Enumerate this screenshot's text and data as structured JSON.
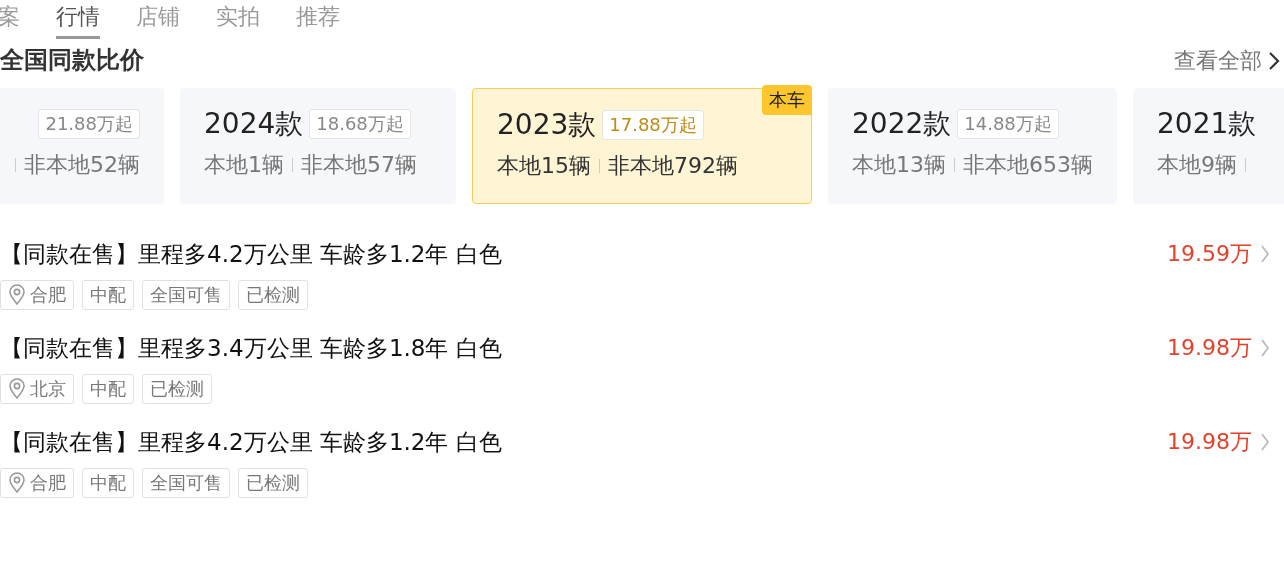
{
  "tabs": [
    {
      "label": "案",
      "selected": false
    },
    {
      "label": "行情",
      "selected": true
    },
    {
      "label": "店铺",
      "selected": false
    },
    {
      "label": "实拍",
      "selected": false
    },
    {
      "label": "推荐",
      "selected": false
    }
  ],
  "title": "全国同款比价",
  "view_all": "查看全部",
  "models": [
    {
      "price": "21.88万起",
      "nonlocal": "非本地52辆",
      "selected": false
    },
    {
      "year": "2024款",
      "price": "18.68万起",
      "local": "本地1辆",
      "nonlocal": "非本地57辆",
      "selected": false
    },
    {
      "year": "2023款",
      "price": "17.88万起",
      "local": "本地15辆",
      "nonlocal": "非本地792辆",
      "selected": true,
      "badge": "本车"
    },
    {
      "year": "2022款",
      "price": "14.88万起",
      "local": "本地13辆",
      "nonlocal": "非本地653辆",
      "selected": false
    },
    {
      "year": "2021款",
      "local": "本地9辆",
      "selected": false
    }
  ],
  "listings": [
    {
      "title": "【同款在售】里程多4.2万公里 车龄多1.2年 白色",
      "price": "19.59万",
      "location": "合肥",
      "tags": [
        "中配",
        "全国可售",
        "已检测"
      ]
    },
    {
      "title": "【同款在售】里程多3.4万公里 车龄多1.8年 白色",
      "price": "19.98万",
      "location": "北京",
      "tags": [
        "中配",
        "已检测"
      ]
    },
    {
      "title": "【同款在售】里程多4.2万公里 车龄多1.2年 白色",
      "price": "19.98万",
      "location": "合肥",
      "tags": [
        "中配",
        "全国可售",
        "已检测"
      ]
    }
  ]
}
